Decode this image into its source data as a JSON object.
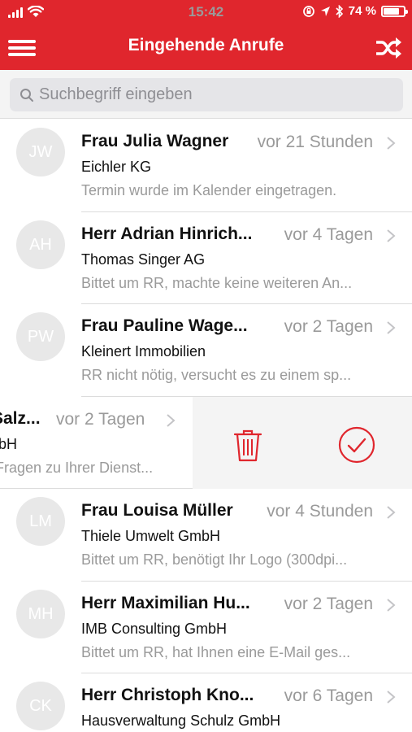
{
  "status_bar": {
    "time": "15:42",
    "battery_text": "74 %",
    "battery_level": 0.74,
    "icons": [
      "signal-icon",
      "wifi-icon",
      "lock-rotation-icon",
      "location-icon",
      "bluetooth-icon",
      "battery-icon"
    ]
  },
  "nav": {
    "title": "Eingehende Anrufe",
    "left_icon": "menu-icon",
    "right_icon": "shuffle-icon"
  },
  "colors": {
    "brand": "#e0262d",
    "accent_action": "#e0262d",
    "muted_text": "#9a9a9a"
  },
  "search": {
    "placeholder": "Suchbegriff eingeben",
    "value": ""
  },
  "calls": [
    {
      "initials": "JW",
      "name": "Frau Julia Wagner",
      "time": "vor 21 Stunden",
      "company": "Eichler KG",
      "note": "Termin wurde im Kalender eingetragen."
    },
    {
      "initials": "AH",
      "name": "Herr Adrian Hinrich...",
      "time": "vor 4 Tagen",
      "company": "Thomas Singer AG",
      "note": "Bittet um RR, machte keine weiteren An..."
    },
    {
      "initials": "PW",
      "name": "Frau Pauline Wage...",
      "time": "vor 2 Tagen",
      "company": "Kleinert Immobilien",
      "note": "RR nicht nötig, versucht es zu einem sp..."
    },
    {
      "name": "Salz...",
      "time": "vor 2 Tagen",
      "company": "bH",
      "note": "Fragen zu Ihrer Dienst...",
      "swiped": true,
      "actions": [
        "trash-icon",
        "checkmark-icon"
      ]
    },
    {
      "initials": "LM",
      "name": "Frau Louisa Müller",
      "time": "vor 4 Stunden",
      "company": "Thiele Umwelt GmbH",
      "note": "Bittet um RR, benötigt Ihr Logo (300dpi..."
    },
    {
      "initials": "MH",
      "name": "Herr Maximilian Hu...",
      "time": "vor 2 Tagen",
      "company": "IMB Consulting GmbH",
      "note": "Bittet um RR, hat Ihnen eine E-Mail ges..."
    },
    {
      "initials": "CK",
      "name": "Herr Christoph Kno...",
      "time": "vor 6 Tagen",
      "company": "Hausverwaltung Schulz GmbH",
      "note": ""
    }
  ]
}
